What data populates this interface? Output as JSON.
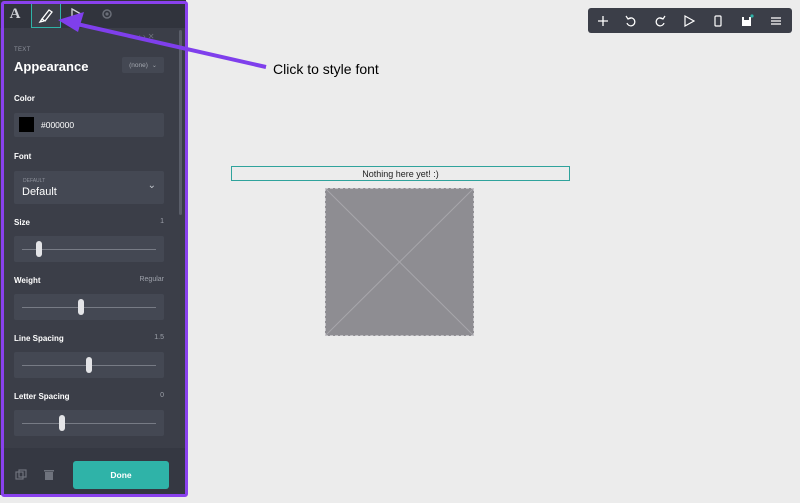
{
  "panel": {
    "tab_text_icon": "A",
    "section_tag": "TEXT",
    "title": "Appearance",
    "preset": "(none)",
    "color_label": "Color",
    "color_value": "#000000",
    "color_swatch": "#000000",
    "font_label": "Font",
    "font_category": "DEFAULT",
    "font_value": "Default",
    "size_label": "Size",
    "size_value": "1",
    "weight_label": "Weight",
    "weight_value": "Regular",
    "line_spacing_label": "Line Spacing",
    "line_spacing_value": "1.5",
    "letter_spacing_label": "Letter Spacing",
    "letter_spacing_value": "0",
    "done_label": "Done",
    "sliders": {
      "size": 0.13,
      "weight": 0.44,
      "line_spacing": 0.5,
      "letter_spacing": 0.3
    }
  },
  "annotation": {
    "text": "Click to style font"
  },
  "canvas": {
    "text_box": "Nothing here yet! :)"
  },
  "colors": {
    "accent": "#2fb3a8",
    "highlight": "#8a41ee",
    "panel_bg": "#3b3e48",
    "canvas_bg": "#ececec"
  },
  "icons": {
    "tabs": [
      "text-tab-icon",
      "style-brush-icon",
      "play-icon",
      "gear-icon"
    ],
    "toolbar": [
      "plus-icon",
      "undo-icon",
      "redo-icon",
      "play-icon",
      "mobile-icon",
      "save-icon",
      "menu-icon"
    ],
    "footer": [
      "duplicate-icon",
      "trash-icon"
    ]
  }
}
